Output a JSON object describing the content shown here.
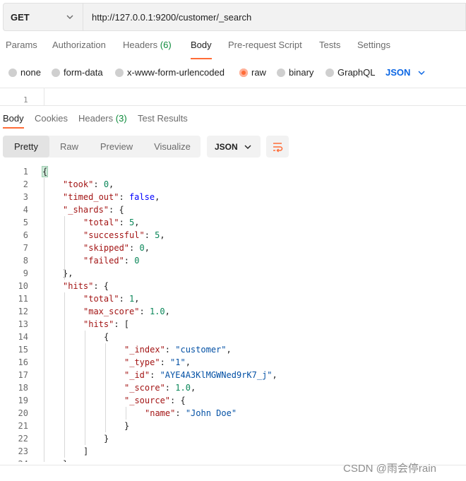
{
  "request": {
    "method": "GET",
    "url": "http://127.0.0.1:9200/customer/_search"
  },
  "request_tabs": [
    {
      "label": "Params",
      "count": ""
    },
    {
      "label": "Authorization",
      "count": ""
    },
    {
      "label": "Headers",
      "count": "(6)"
    },
    {
      "label": "Body",
      "count": "",
      "active": true
    },
    {
      "label": "Pre-request Script",
      "count": ""
    },
    {
      "label": "Tests",
      "count": ""
    },
    {
      "label": "Settings",
      "count": ""
    }
  ],
  "body_types": [
    {
      "label": "none",
      "selected": false
    },
    {
      "label": "form-data",
      "selected": false
    },
    {
      "label": "x-www-form-urlencoded",
      "selected": false
    },
    {
      "label": "raw",
      "selected": true
    },
    {
      "label": "binary",
      "selected": false
    },
    {
      "label": "GraphQL",
      "selected": false
    }
  ],
  "raw_language": "JSON",
  "editor": {
    "first_line": "1"
  },
  "response_tabs": [
    {
      "label": "Body",
      "count": "",
      "active": true
    },
    {
      "label": "Cookies",
      "count": ""
    },
    {
      "label": "Headers",
      "count": "(3)"
    },
    {
      "label": "Test Results",
      "count": ""
    }
  ],
  "view_modes": [
    {
      "label": "Pretty",
      "active": true
    },
    {
      "label": "Raw",
      "active": false
    },
    {
      "label": "Preview",
      "active": false
    },
    {
      "label": "Visualize",
      "active": false
    }
  ],
  "response_format": "JSON",
  "icons": {
    "method_dropdown": "chevron-down-icon",
    "language_dropdown": "chevron-down-icon",
    "format_dropdown": "chevron-down-icon",
    "wrap": "wrap-lines-icon"
  },
  "colors": {
    "accent": "#ff6c37",
    "json_link": "#0b66e4",
    "count_green": "#0c8a3a"
  },
  "response_lines": [
    {
      "num": "1",
      "indent": 0,
      "tokens": [
        {
          "t": "{",
          "c": "bb"
        }
      ]
    },
    {
      "num": "2",
      "indent": 1,
      "tokens": [
        {
          "t": "\"took\"",
          "c": "k"
        },
        {
          "t": ": ",
          "c": "p"
        },
        {
          "t": "0",
          "c": "n"
        },
        {
          "t": ",",
          "c": "p"
        }
      ]
    },
    {
      "num": "3",
      "indent": 1,
      "tokens": [
        {
          "t": "\"timed_out\"",
          "c": "k"
        },
        {
          "t": ": ",
          "c": "p"
        },
        {
          "t": "false",
          "c": "b"
        },
        {
          "t": ",",
          "c": "p"
        }
      ]
    },
    {
      "num": "4",
      "indent": 1,
      "tokens": [
        {
          "t": "\"_shards\"",
          "c": "k"
        },
        {
          "t": ": {",
          "c": "p"
        }
      ]
    },
    {
      "num": "5",
      "indent": 2,
      "tokens": [
        {
          "t": "\"total\"",
          "c": "k"
        },
        {
          "t": ": ",
          "c": "p"
        },
        {
          "t": "5",
          "c": "n"
        },
        {
          "t": ",",
          "c": "p"
        }
      ]
    },
    {
      "num": "6",
      "indent": 2,
      "tokens": [
        {
          "t": "\"successful\"",
          "c": "k"
        },
        {
          "t": ": ",
          "c": "p"
        },
        {
          "t": "5",
          "c": "n"
        },
        {
          "t": ",",
          "c": "p"
        }
      ]
    },
    {
      "num": "7",
      "indent": 2,
      "tokens": [
        {
          "t": "\"skipped\"",
          "c": "k"
        },
        {
          "t": ": ",
          "c": "p"
        },
        {
          "t": "0",
          "c": "n"
        },
        {
          "t": ",",
          "c": "p"
        }
      ]
    },
    {
      "num": "8",
      "indent": 2,
      "tokens": [
        {
          "t": "\"failed\"",
          "c": "k"
        },
        {
          "t": ": ",
          "c": "p"
        },
        {
          "t": "0",
          "c": "n"
        }
      ]
    },
    {
      "num": "9",
      "indent": 1,
      "tokens": [
        {
          "t": "},",
          "c": "p"
        }
      ]
    },
    {
      "num": "10",
      "indent": 1,
      "tokens": [
        {
          "t": "\"hits\"",
          "c": "k"
        },
        {
          "t": ": {",
          "c": "p"
        }
      ]
    },
    {
      "num": "11",
      "indent": 2,
      "tokens": [
        {
          "t": "\"total\"",
          "c": "k"
        },
        {
          "t": ": ",
          "c": "p"
        },
        {
          "t": "1",
          "c": "n"
        },
        {
          "t": ",",
          "c": "p"
        }
      ]
    },
    {
      "num": "12",
      "indent": 2,
      "tokens": [
        {
          "t": "\"max_score\"",
          "c": "k"
        },
        {
          "t": ": ",
          "c": "p"
        },
        {
          "t": "1.0",
          "c": "n"
        },
        {
          "t": ",",
          "c": "p"
        }
      ]
    },
    {
      "num": "13",
      "indent": 2,
      "tokens": [
        {
          "t": "\"hits\"",
          "c": "k"
        },
        {
          "t": ": [",
          "c": "p"
        }
      ]
    },
    {
      "num": "14",
      "indent": 3,
      "tokens": [
        {
          "t": "{",
          "c": "p"
        }
      ]
    },
    {
      "num": "15",
      "indent": 4,
      "tokens": [
        {
          "t": "\"_index\"",
          "c": "k"
        },
        {
          "t": ": ",
          "c": "p"
        },
        {
          "t": "\"customer\"",
          "c": "s"
        },
        {
          "t": ",",
          "c": "p"
        }
      ]
    },
    {
      "num": "16",
      "indent": 4,
      "tokens": [
        {
          "t": "\"_type\"",
          "c": "k"
        },
        {
          "t": ": ",
          "c": "p"
        },
        {
          "t": "\"1\"",
          "c": "s"
        },
        {
          "t": ",",
          "c": "p"
        }
      ]
    },
    {
      "num": "17",
      "indent": 4,
      "tokens": [
        {
          "t": "\"_id\"",
          "c": "k"
        },
        {
          "t": ": ",
          "c": "p"
        },
        {
          "t": "\"AYE4A3KlMGWNed9rK7_j\"",
          "c": "s"
        },
        {
          "t": ",",
          "c": "p"
        }
      ]
    },
    {
      "num": "18",
      "indent": 4,
      "tokens": [
        {
          "t": "\"_score\"",
          "c": "k"
        },
        {
          "t": ": ",
          "c": "p"
        },
        {
          "t": "1.0",
          "c": "n"
        },
        {
          "t": ",",
          "c": "p"
        }
      ]
    },
    {
      "num": "19",
      "indent": 4,
      "tokens": [
        {
          "t": "\"_source\"",
          "c": "k"
        },
        {
          "t": ": {",
          "c": "p"
        }
      ]
    },
    {
      "num": "20",
      "indent": 5,
      "tokens": [
        {
          "t": "\"name\"",
          "c": "k"
        },
        {
          "t": ": ",
          "c": "p"
        },
        {
          "t": "\"John Doe\"",
          "c": "s"
        }
      ]
    },
    {
      "num": "21",
      "indent": 4,
      "tokens": [
        {
          "t": "}",
          "c": "p"
        }
      ]
    },
    {
      "num": "22",
      "indent": 3,
      "tokens": [
        {
          "t": "}",
          "c": "p"
        }
      ]
    },
    {
      "num": "23",
      "indent": 2,
      "tokens": [
        {
          "t": "]",
          "c": "p"
        }
      ]
    },
    {
      "num": "24",
      "indent": 1,
      "tokens": [
        {
          "t": "}",
          "c": "p"
        }
      ]
    }
  ],
  "watermark": "CSDN @雨会停rain"
}
